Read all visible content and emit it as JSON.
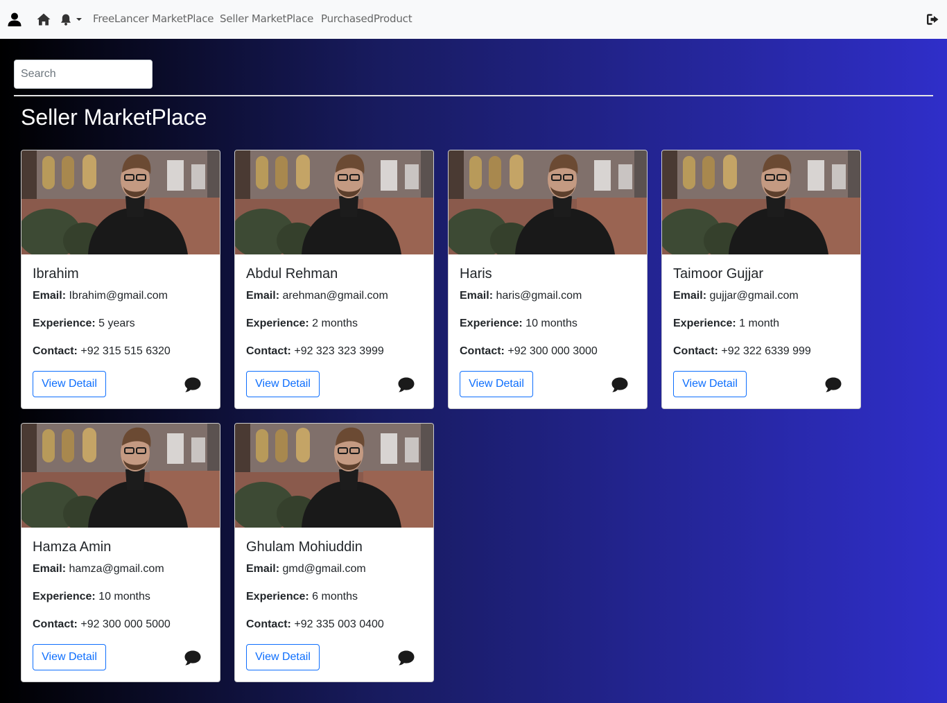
{
  "navbar": {
    "links": [
      {
        "label": "FreeLancer MarketPlace"
      },
      {
        "label": "Seller MarketPlace"
      },
      {
        "label": "PurchasedProduct"
      }
    ],
    "icons": [
      "user-icon",
      "home-icon",
      "bell-icon",
      "caret-down-icon",
      "logout-icon"
    ]
  },
  "search": {
    "placeholder": "Search"
  },
  "page_title": "Seller MarketPlace",
  "labels": {
    "email": "Email:",
    "experience": "Experience:",
    "contact": "Contact:",
    "view_detail": "View Detail"
  },
  "sellers": [
    {
      "name": "Ibrahim",
      "email": "Ibrahim@gmail.com",
      "experience": "5 years",
      "contact": "+92 315 515 6320"
    },
    {
      "name": "Abdul Rehman",
      "email": "arehman@gmail.com",
      "experience": "2 months",
      "contact": "+92 323 323 3999"
    },
    {
      "name": "Haris",
      "email": "haris@gmail.com",
      "experience": "10 months",
      "contact": "+92 300 000 3000"
    },
    {
      "name": "Taimoor Gujjar",
      "email": "gujjar@gmail.com",
      "experience": "1 month",
      "contact": "+92 322 6339 999"
    },
    {
      "name": "Hamza Amin",
      "email": "hamza@gmail.com",
      "experience": "10 months",
      "contact": "+92 300 000 5000"
    },
    {
      "name": "Ghulam Mohiuddin",
      "email": "gmd@gmail.com",
      "experience": "6 months",
      "contact": "+92 335 003 0400"
    }
  ],
  "colors": {
    "gradient_start": "#000000",
    "gradient_end": "#2f2ec9",
    "button_primary": "#0d6efd",
    "navbar_bg": "#f8f9fa"
  }
}
